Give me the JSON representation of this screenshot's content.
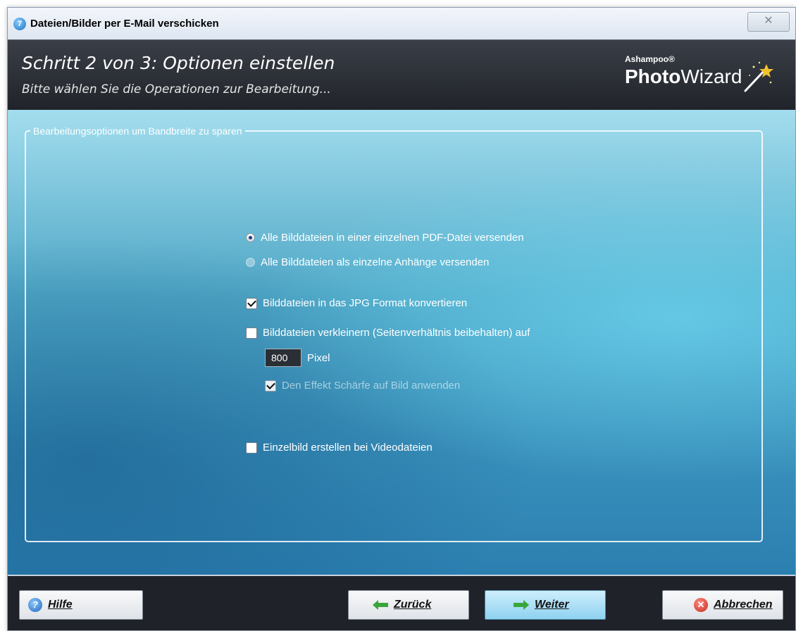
{
  "window": {
    "title": "Dateien/Bilder per E-Mail verschicken",
    "app_icon_glyph": "7",
    "close_glyph": "✕"
  },
  "header": {
    "step_title": "Schritt 2 von 3: Optionen einstellen",
    "step_subtitle": "Bitte wählen Sie die Operationen zur Bearbeitung...",
    "logo_brand": "Ashampoo®",
    "logo_product_bold": "Photo",
    "logo_product_rest": "Wizard"
  },
  "group": {
    "legend": "Bearbeitungsoptionen um Bandbreite zu sparen"
  },
  "options": {
    "radio_pdf": {
      "label": "Alle Bilddateien in einer einzelnen PDF-Datei versenden",
      "selected": true
    },
    "radio_attachments": {
      "label": "Alle Bilddateien als einzelne Anhänge versenden",
      "selected": false
    },
    "check_jpg": {
      "label": "Bilddateien in das JPG Format konvertieren",
      "checked": true
    },
    "check_resize": {
      "label": "Bilddateien verkleinern (Seitenverhältnis beibehalten) auf",
      "checked": false
    },
    "resize_value": "800",
    "resize_unit": "Pixel",
    "check_sharpen": {
      "label": "Den Effekt Schärfe auf Bild anwenden",
      "checked": true,
      "enabled": false
    },
    "check_video": {
      "label": "Einzelbild erstellen bei Videodateien",
      "checked": false
    }
  },
  "footer": {
    "help_label": "Hilfe",
    "back_label": "Zurück",
    "next_label": "Weiter",
    "cancel_label": "Abbrechen"
  },
  "colors": {
    "header_bg": "#2a2e35",
    "content_accent": "#4fb8dc",
    "next_button": "#a8e0f5"
  }
}
